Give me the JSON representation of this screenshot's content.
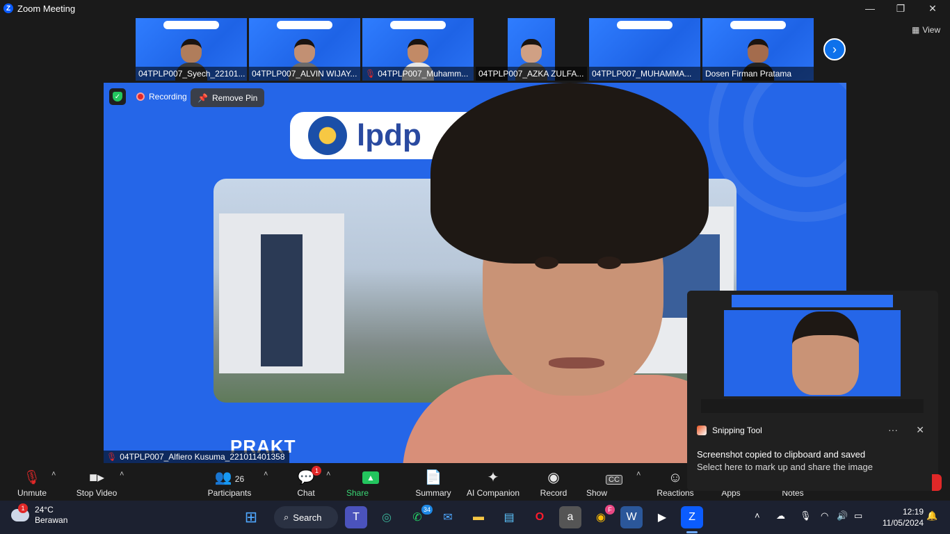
{
  "window": {
    "title": "Zoom Meeting",
    "app_icon": "Z",
    "minimize": "—",
    "restore": "❐",
    "close": "✕"
  },
  "view_button": {
    "label": "View",
    "icon": "grid-icon"
  },
  "thumbnails": [
    {
      "name": "04TPLP007_Syech_22101...",
      "muted": false
    },
    {
      "name": "04TPLP007_ALVIN WIJAY...",
      "muted": false
    },
    {
      "name": "04TPLP007_Muhamm...",
      "muted": true
    },
    {
      "name": "04TPLP007_AZKA ZULFA...",
      "muted": false
    },
    {
      "name": "04TPLP007_MUHAMMA...",
      "muted": false
    },
    {
      "name": "Dosen Firman Pratama",
      "muted": false
    }
  ],
  "main_video": {
    "logo_text": "lpdp",
    "slide_text": "PRAKT",
    "speaker_name": "04TPLP007_Alfiero Kusuma_221011401358",
    "speaker_muted": true
  },
  "overlay": {
    "recording_label": "Recording",
    "remove_pin_label": "Remove Pin"
  },
  "toolbar": {
    "unmute": "Unmute",
    "stop_video": "Stop Video",
    "participants": "Participants",
    "participants_count": "26",
    "chat": "Chat",
    "chat_badge": "1",
    "share_screen": "Share Screen",
    "summary": "Summary",
    "ai_companion": "AI Companion",
    "record": "Record",
    "show_captions": "Show Captions",
    "captions_icon": "CC",
    "reactions": "Reactions",
    "apps": "Apps",
    "notes": "Notes"
  },
  "notification": {
    "app_name": "Snipping Tool",
    "more": "···",
    "close": "✕",
    "title": "Screenshot copied to clipboard and saved",
    "body": "Select here to mark up and share the image"
  },
  "taskbar": {
    "weather_badge": "1",
    "temperature": "24°C",
    "condition": "Berawan",
    "search_label": "Search",
    "whatsapp_badge": "34",
    "chrome_badge": "F",
    "time": "12:19",
    "date": "11/05/2024"
  },
  "colors": {
    "accent": "#0e71eb",
    "share_green": "#23c55e",
    "record_red": "#e02828",
    "slide_blue": "#2566e8"
  }
}
